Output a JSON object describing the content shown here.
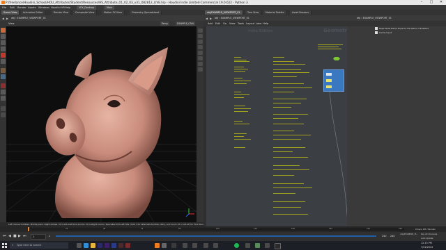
{
  "window": {
    "title": "P:/freelance/Houdini_School/HOU_Attributes/Student/Resources/HS_Attribute_01_02_03_v31_082812_LIVE.hip - Houdini Indie Limited-Commercial 19.0.622 - Python 3",
    "controls": {
      "minimize": "–",
      "maximize": "□",
      "close": "✕"
    }
  },
  "menubar": {
    "items": [
      "File",
      "Edit",
      "Render",
      "Assets",
      "Windows",
      "Houdini VR",
      "Help"
    ],
    "desktop": "VFX_Desktop",
    "main": "Main"
  },
  "left_tabs": [
    {
      "label": "Scene View",
      "active": true
    },
    {
      "label": "Animation Editor"
    },
    {
      "label": "Render View"
    },
    {
      "label": "Composite View"
    },
    {
      "label": "Motion FX View"
    },
    {
      "label": "Geometry Spreadsheet"
    }
  ],
  "right_tabs": [
    {
      "label": "obj/EXAMPLE_VIEWPORT_01",
      "active": true
    },
    {
      "label": "Tree View"
    },
    {
      "label": "Material Palette"
    },
    {
      "label": "Asset Browser"
    }
  ],
  "viewport": {
    "path": "obj › EXAMPLE_VIEWPORT_01",
    "view_label": "View",
    "persp": "Persp",
    "camera": "EXAMPLE_CAM",
    "status_text": "Left mouse tumbles. Middle pans. Right dollies. Ctrl+Alt+Left box-zooms. Ctrl+Right zooms. Spacebar-Ctrl-Left tilts. Hold L for alternate tumble, dolly, and zoom.   M or Alt+M for First Person Navigation."
  },
  "network_editor": {
    "path": "obj › EXAMPLE_VIEWPORT_01",
    "menu": [
      "Add",
      "Edit",
      "Go",
      "View",
      "Tools",
      "Layout",
      "Labs",
      "Help"
    ],
    "watermark_left": "Indie Edition",
    "watermark_right": "Geometry"
  },
  "params": {
    "path": "obj › EXAMPLE_VIEWPORT_01",
    "checkbox1": "Keep Node Name Equal to File Name if Enabled",
    "checkbox2": "Cache Input"
  },
  "timeline": {
    "frame": "1",
    "start": "1",
    "end": "240",
    "end2": "240",
    "ticks": [
      "1",
      "24",
      "48",
      "72",
      "96",
      "120",
      "144",
      "168",
      "192",
      "216",
      "240"
    ],
    "keys_label": "0 keys, 0/0 channels",
    "key_all": "Key All Channels",
    "auto_update": "Auto Update",
    "context": "/obj/EXAMPLE_VI..."
  },
  "taskbar": {
    "search": "Type here to search",
    "time": "12:15 PM",
    "date": "7/22/2022"
  },
  "colors": {
    "accent": "#f07c1c",
    "node_blue": "#3b78c2",
    "node_green": "#7dc832",
    "sticky_text": "#c9c81f"
  }
}
